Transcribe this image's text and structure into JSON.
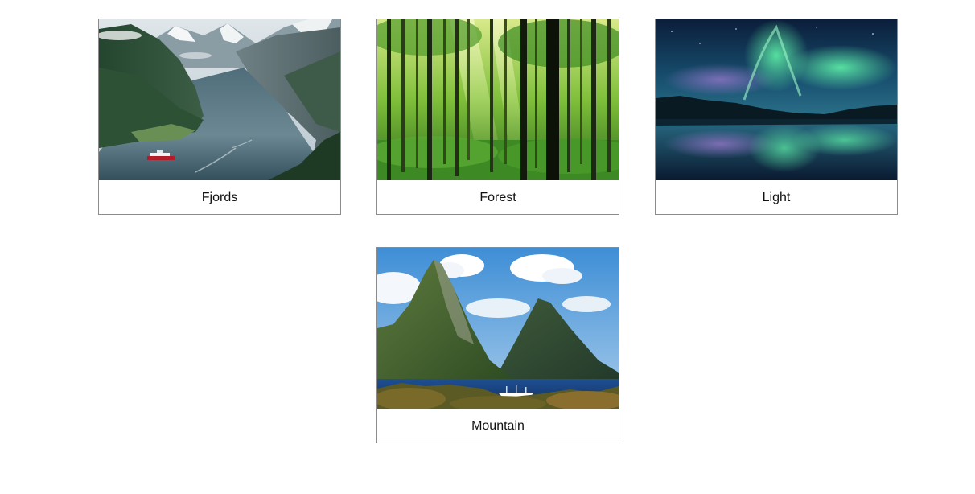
{
  "gallery": {
    "items": [
      {
        "label": "Fjords",
        "image": "fjord-landscape-photo"
      },
      {
        "label": "Forest",
        "image": "forest-photo"
      },
      {
        "label": "Light",
        "image": "aurora-lake-photo"
      },
      {
        "label": "Mountain",
        "image": "twin-peaks-bay-photo"
      }
    ]
  }
}
